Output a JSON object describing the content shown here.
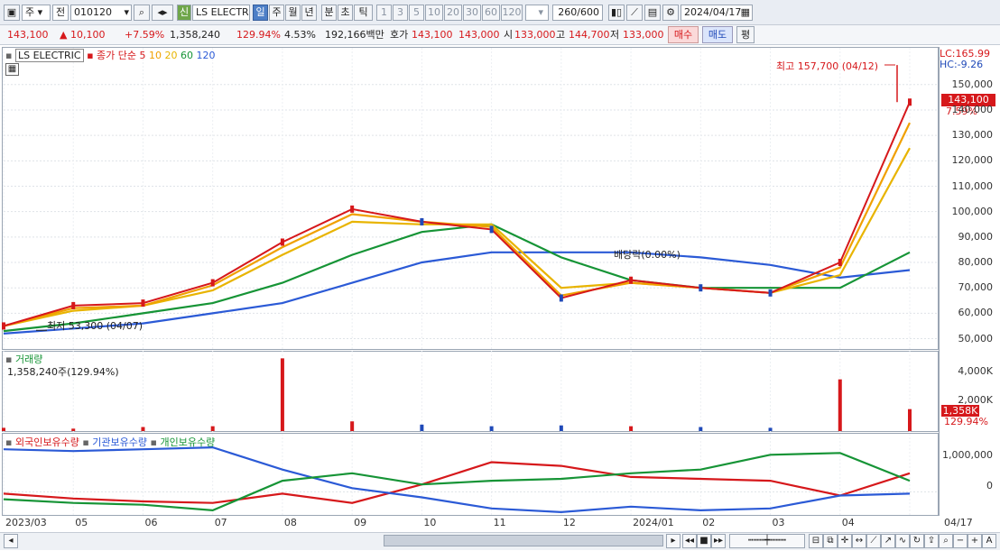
{
  "toolbar": {
    "market_label": "주",
    "prev_label": "전",
    "code_value": "010120",
    "badge_label": "신",
    "name_value": "LS ELECTRI",
    "periods": [
      "일",
      "주",
      "월",
      "년",
      "분",
      "초",
      "틱"
    ],
    "selected_period": "일",
    "intervals": [
      "1",
      "3",
      "5",
      "10",
      "20",
      "30",
      "60",
      "120"
    ],
    "count_value": "260",
    "count_total": "/600",
    "date_value": "2024/04/17"
  },
  "quote": {
    "price": "143,100",
    "change": "▲ 10,100",
    "change_pct": "+7.59%",
    "volume": "1,358,240",
    "volume_ratio": "129.94%",
    "turnover": "4.53%",
    "amount": "192,166백만",
    "ask_label": "호가",
    "ask_price": "143,100",
    "bid_price": "143,000",
    "open_label": "시",
    "open": "133,000",
    "high_label": "고",
    "high": "144,700",
    "low_label": "저",
    "low": "133,000",
    "buy_label": "매수",
    "sell_label": "매도",
    "eval_label": "평"
  },
  "price_panel": {
    "title": "LS ELECTRIC",
    "ma_label": "종가 단순 5",
    "ma_periods": [
      "10",
      "20",
      "60",
      "120"
    ],
    "ma_colors": [
      "#d6181b",
      "#f0a000",
      "#e8b400",
      "#169436",
      "#2b5ad6"
    ],
    "high_marker": "최고 157,700 (04/12)",
    "low_marker": "최저 53,300 (04/07)",
    "dividend_label": "배당락(0.00%)",
    "lc_label": "LC:165.99",
    "hc_label": "HC:-9.26",
    "price_tag": "143,100",
    "pct_tag": "7.59%",
    "y_ticks": [
      "150,000",
      "140,000",
      "130,000",
      "120,000",
      "110,000",
      "100,000",
      "90,000",
      "80,000",
      "70,000",
      "60,000",
      "50,000"
    ]
  },
  "volume_panel": {
    "title": "거래량",
    "value_text": "1,358,240주(129.94%)",
    "y_ticks": [
      "4,000K",
      "2,000K"
    ],
    "tag_value": "1,358K",
    "tag_pct": "129.94%"
  },
  "holding_panel": {
    "legend": [
      "외국인보유수량",
      "기관보유수량",
      "개인보유수량"
    ],
    "y_ticks": [
      "1,000,000",
      "0"
    ]
  },
  "x_axis": {
    "labels": [
      "2023/03",
      "05",
      "06",
      "07",
      "08",
      "09",
      "10",
      "11",
      "12",
      "2024/01",
      "02",
      "03",
      "04",
      "04/17"
    ]
  },
  "chart_data": {
    "type": "line",
    "title": "LS ELECTRIC",
    "x": [
      "2023/03",
      "2023/04",
      "2023/05",
      "2023/06",
      "2023/07",
      "2023/08",
      "2023/09",
      "2023/10",
      "2023/11",
      "2023/12",
      "2024/01",
      "2024/02",
      "2024/03",
      "2024/04/17"
    ],
    "series": [
      {
        "name": "종가 단순 5",
        "values": [
          55000,
          63000,
          64000,
          72000,
          88000,
          101000,
          96000,
          93000,
          66000,
          73000,
          70000,
          68000,
          80000,
          143100
        ]
      },
      {
        "name": "10",
        "values": [
          55000,
          62000,
          63000,
          71000,
          86000,
          99000,
          96000,
          94000,
          67000,
          72000,
          70000,
          68000,
          78000,
          135000
        ]
      },
      {
        "name": "20",
        "values": [
          55000,
          61000,
          63000,
          69000,
          83000,
          96000,
          95000,
          95000,
          70000,
          72000,
          70000,
          68000,
          75000,
          125000
        ]
      },
      {
        "name": "60",
        "values": [
          53000,
          56000,
          60000,
          64000,
          72000,
          83000,
          92000,
          95000,
          82000,
          73000,
          70000,
          70000,
          70000,
          84000
        ]
      },
      {
        "name": "120",
        "values": [
          52000,
          54000,
          56000,
          60000,
          64000,
          72000,
          80000,
          84000,
          84000,
          84000,
          82000,
          79000,
          74000,
          77000
        ]
      }
    ],
    "volume_bars_k": [
      200,
      150,
      250,
      300,
      4500,
      600,
      400,
      300,
      350,
      300,
      250,
      200,
      3200,
      1358
    ],
    "ylim": [
      47000,
      162000
    ],
    "volume_ylim": [
      0,
      4800
    ],
    "high": {
      "value": 157700,
      "date": "04/12"
    },
    "low": {
      "value": 53300,
      "date": "04/07"
    },
    "holdings": [
      {
        "name": "외국인보유수량",
        "values": [
          -50000,
          -180000,
          -260000,
          -300000,
          -50000,
          -300000,
          200000,
          800000,
          700000,
          400000,
          350000,
          300000,
          -100000,
          500000
        ]
      },
      {
        "name": "기관보유수량",
        "values": [
          1150000,
          1100000,
          1150000,
          1200000,
          600000,
          100000,
          -150000,
          -450000,
          -550000,
          -400000,
          -500000,
          -450000,
          -100000,
          -50000
        ]
      },
      {
        "name": "개인보유수량",
        "values": [
          -200000,
          -300000,
          -350000,
          -500000,
          300000,
          500000,
          200000,
          300000,
          350000,
          500000,
          600000,
          1000000,
          1050000,
          300000
        ]
      }
    ],
    "holdings_ylim": [
      -600000,
      1300000
    ]
  }
}
